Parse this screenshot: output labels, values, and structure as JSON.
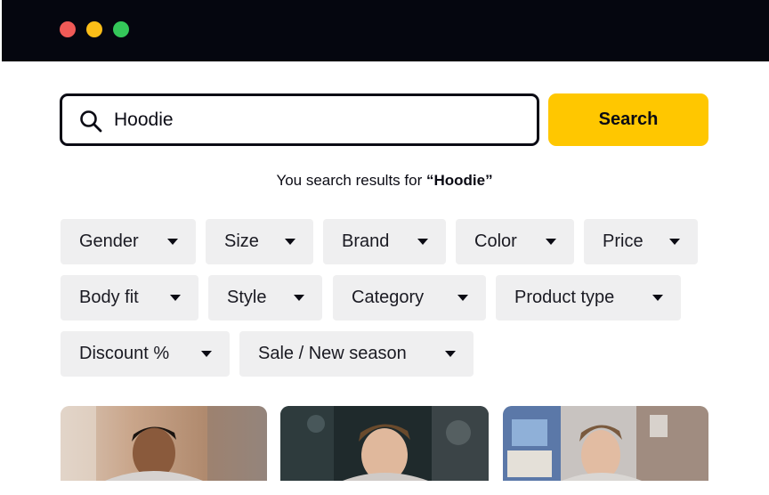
{
  "window": {
    "dots": [
      {
        "name": "close",
        "color": "#f05a57"
      },
      {
        "name": "minimize",
        "color": "#fbbd18"
      },
      {
        "name": "maximize",
        "color": "#34c759"
      }
    ]
  },
  "search": {
    "value": "Hoodie",
    "icon": "search-icon",
    "button_label": "Search",
    "button_color": "#ffc700"
  },
  "results": {
    "prefix": "You search results for ",
    "open_quote": "“",
    "query": "Hoodie",
    "close_quote": "”"
  },
  "filters": [
    {
      "label": "Gender"
    },
    {
      "label": "Size"
    },
    {
      "label": "Brand"
    },
    {
      "label": "Color"
    },
    {
      "label": "Price"
    },
    {
      "label": "Body fit"
    },
    {
      "label": "Style"
    },
    {
      "label": "Category"
    },
    {
      "label": "Product type"
    },
    {
      "label": "Discount %"
    },
    {
      "label": "Sale / New season"
    }
  ],
  "colors": {
    "chip_bg": "#efeff0",
    "titlebar_bg": "#05060f"
  },
  "products": [
    {
      "name": "product-card-1",
      "image": "man-in-hoodie-outdoor-street"
    },
    {
      "name": "product-card-2",
      "image": "man-in-hoodie-dark-background"
    },
    {
      "name": "product-card-3",
      "image": "man-in-hoodie-graffiti-wall"
    }
  ]
}
